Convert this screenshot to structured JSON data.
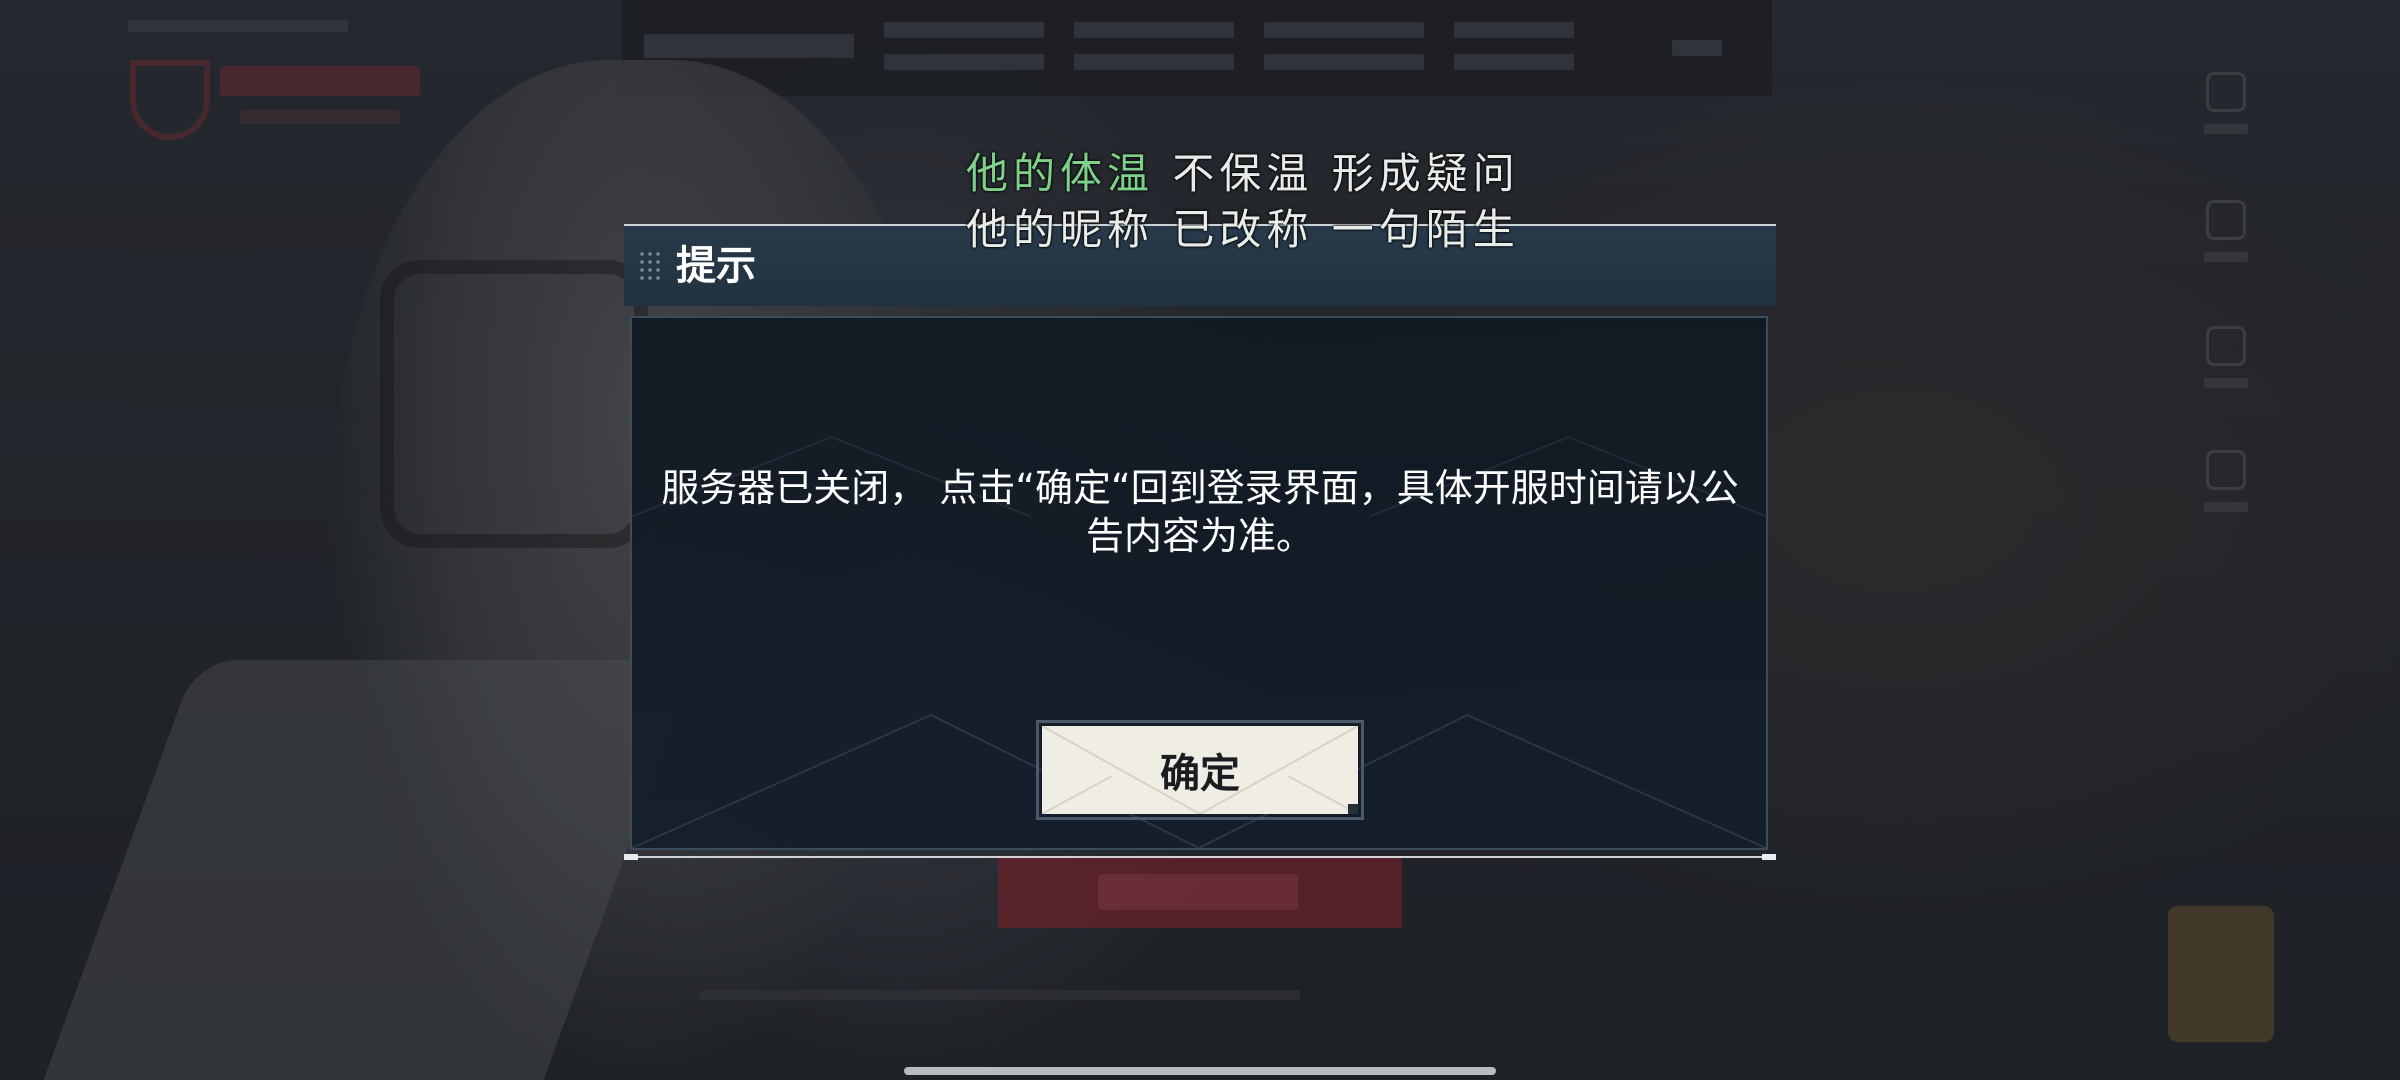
{
  "lyrics": {
    "line1_highlight": "他的体温",
    "line1_rest": " 不保温 形成疑问",
    "line2": "他的昵称 已改称 一句陌生"
  },
  "dialog": {
    "title": "提示",
    "message": "服务器已关闭， 点击“确定“回到登录界面，具体开服时间请以公告内容为准。",
    "confirm_label": "确定"
  },
  "colors": {
    "lyric_highlight": "#7ed08a",
    "dialog_header": "#283a4b",
    "confirm_button_bg": "#f0ede4"
  }
}
